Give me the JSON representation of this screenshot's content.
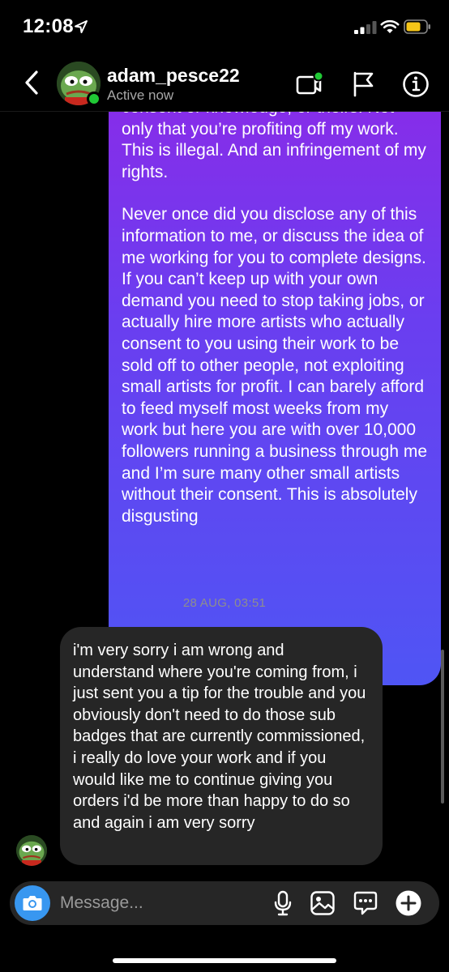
{
  "status_bar": {
    "time": "12:08"
  },
  "header": {
    "contact_name": "adam_pesce22",
    "contact_status": "Active now",
    "icons": [
      "back-icon",
      "video-call-icon",
      "flag-icon",
      "info-icon"
    ]
  },
  "conversation": {
    "sent_message": {
      "paragraph_1": "consent or knowledge, or theirs. Not only that you’re profiting off my work. This is illegal. And an infringement of my rights.",
      "paragraph_2": "Never once did you disclose any of this information to me, or discuss the idea of me working for you to complete designs. If you can’t keep up with your own demand you need to stop taking jobs, or actually hire more artists  who actually consent to you using their work to be sold off to other people, not exploiting small artists for profit. I can barely afford to feed myself most weeks from my work but here you are with over 10,000 followers running a business through me and I’m sure many other small artists without their consent. This is absolutely disgusting"
    },
    "timestamp": "28 AUG, 03:51",
    "received_message": "i'm very sorry i am wrong and understand where you're coming from, i just sent you a tip for the trouble and you obviously don't need to do those sub badges that are currently commissioned, i really do love your work and if you would like me to continue giving you orders i'd be more than happy to do so and again i am very sorry"
  },
  "composer": {
    "placeholder": "Message...",
    "icons": [
      "camera-icon",
      "microphone-icon",
      "gallery-icon",
      "sticker-icon",
      "plus-icon"
    ]
  },
  "colors": {
    "sent_gradient_top": "#8a2be8",
    "sent_gradient_bottom": "#4f55f4",
    "received_bubble": "#262626",
    "camera_button": "#3897f0",
    "online_dot": "#20c935",
    "video_active_dot": "#20c935",
    "battery_level": "#f5c518"
  }
}
